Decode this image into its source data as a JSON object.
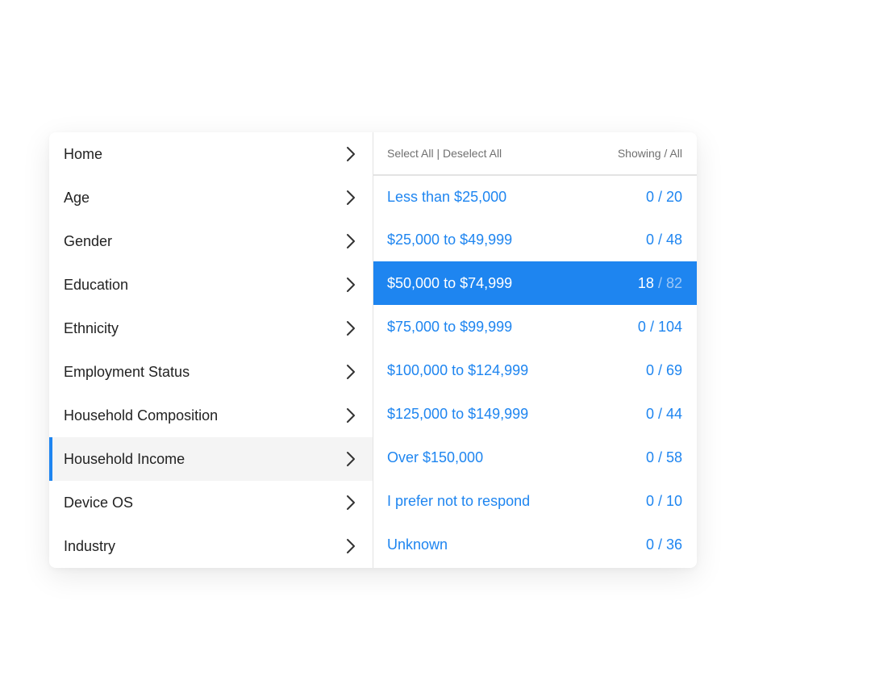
{
  "sidebar": {
    "items": [
      {
        "label": "Home"
      },
      {
        "label": "Age"
      },
      {
        "label": "Gender"
      },
      {
        "label": "Education"
      },
      {
        "label": "Ethnicity"
      },
      {
        "label": "Employment Status"
      },
      {
        "label": "Household Composition"
      },
      {
        "label": "Household Income"
      },
      {
        "label": "Device OS"
      },
      {
        "label": "Industry"
      }
    ],
    "active": "Household Income"
  },
  "content": {
    "header": {
      "select_all": "Select All",
      "separator": " | ",
      "deselect_all": "Deselect All",
      "showing_all": "Showing / All"
    },
    "rows": [
      {
        "label": "Less than $25,000",
        "showing": "0",
        "total": "20"
      },
      {
        "label": "$25,000 to $49,999",
        "showing": "0",
        "total": "48"
      },
      {
        "label": "$50,000 to $74,999",
        "showing": "18",
        "total": "82"
      },
      {
        "label": "$75,000 to $99,999",
        "showing": "0",
        "total": "104"
      },
      {
        "label": "$100,000 to $124,999",
        "showing": "0",
        "total": "69"
      },
      {
        "label": "$125,000 to $149,999",
        "showing": "0",
        "total": "44"
      },
      {
        "label": "Over $150,000",
        "showing": "0",
        "total": "58"
      },
      {
        "label": "I prefer not to respond",
        "showing": "0",
        "total": "10"
      },
      {
        "label": "Unknown",
        "showing": "0",
        "total": "36"
      }
    ],
    "selected": "$50,000 to $74,999",
    "count_separator": " / "
  },
  "colors": {
    "accent": "#1e85f0",
    "active_bg": "#f4f4f4",
    "text": "#222222",
    "muted": "#707070"
  },
  "icons": {
    "sidebar_item": "chevron-right-icon"
  }
}
